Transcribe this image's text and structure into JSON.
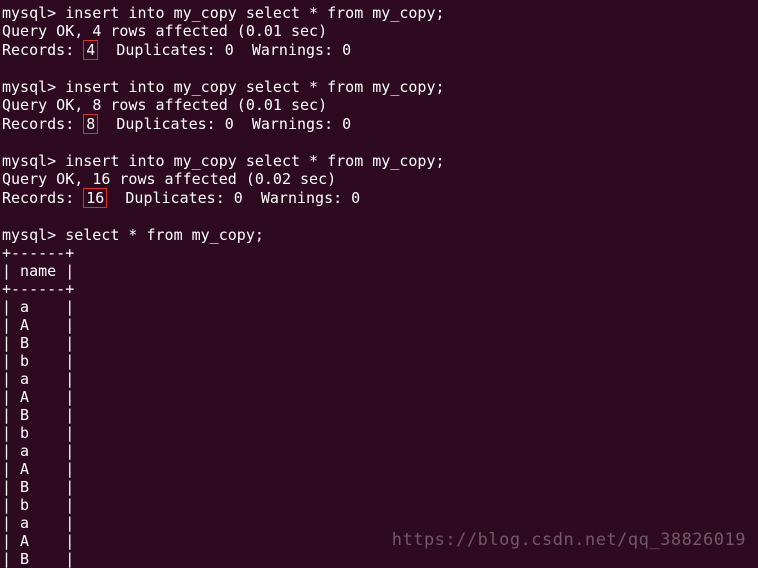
{
  "blocks": [
    {
      "prompt": "mysql> ",
      "query": "insert into my_copy select * from my_copy;",
      "result_prefix": "Query OK, ",
      "result_suffix": " rows affected (0.01 sec)",
      "records_prefix": "Records: ",
      "records_value": "4",
      "records_suffix": "  Duplicates: 0  Warnings: 0",
      "rows_affected": "4"
    },
    {
      "prompt": "mysql> ",
      "query": "insert into my_copy select * from my_copy;",
      "result_prefix": "Query OK, ",
      "result_suffix": " rows affected (0.01 sec)",
      "records_prefix": "Records: ",
      "records_value": "8",
      "records_suffix": "  Duplicates: 0  Warnings: 0",
      "rows_affected": "8"
    },
    {
      "prompt": "mysql> ",
      "query": "insert into my_copy select * from my_copy;",
      "result_prefix": "Query OK, ",
      "result_suffix": " rows affected (0.02 sec)",
      "records_prefix": "Records: ",
      "records_value": "16",
      "records_suffix": "  Duplicates: 0  Warnings: 0",
      "rows_affected": "16"
    }
  ],
  "select": {
    "prompt": "mysql> ",
    "query": "select * from my_copy;",
    "border": "+------+",
    "header": "| name |",
    "rows": [
      "| a    |",
      "| A    |",
      "| B    |",
      "| b    |",
      "| a    |",
      "| A    |",
      "| B    |",
      "| b    |",
      "| a    |",
      "| A    |",
      "| B    |",
      "| b    |",
      "| a    |",
      "| A    |",
      "| B    |"
    ]
  },
  "watermark": "https://blog.csdn.net/qq_38826019"
}
